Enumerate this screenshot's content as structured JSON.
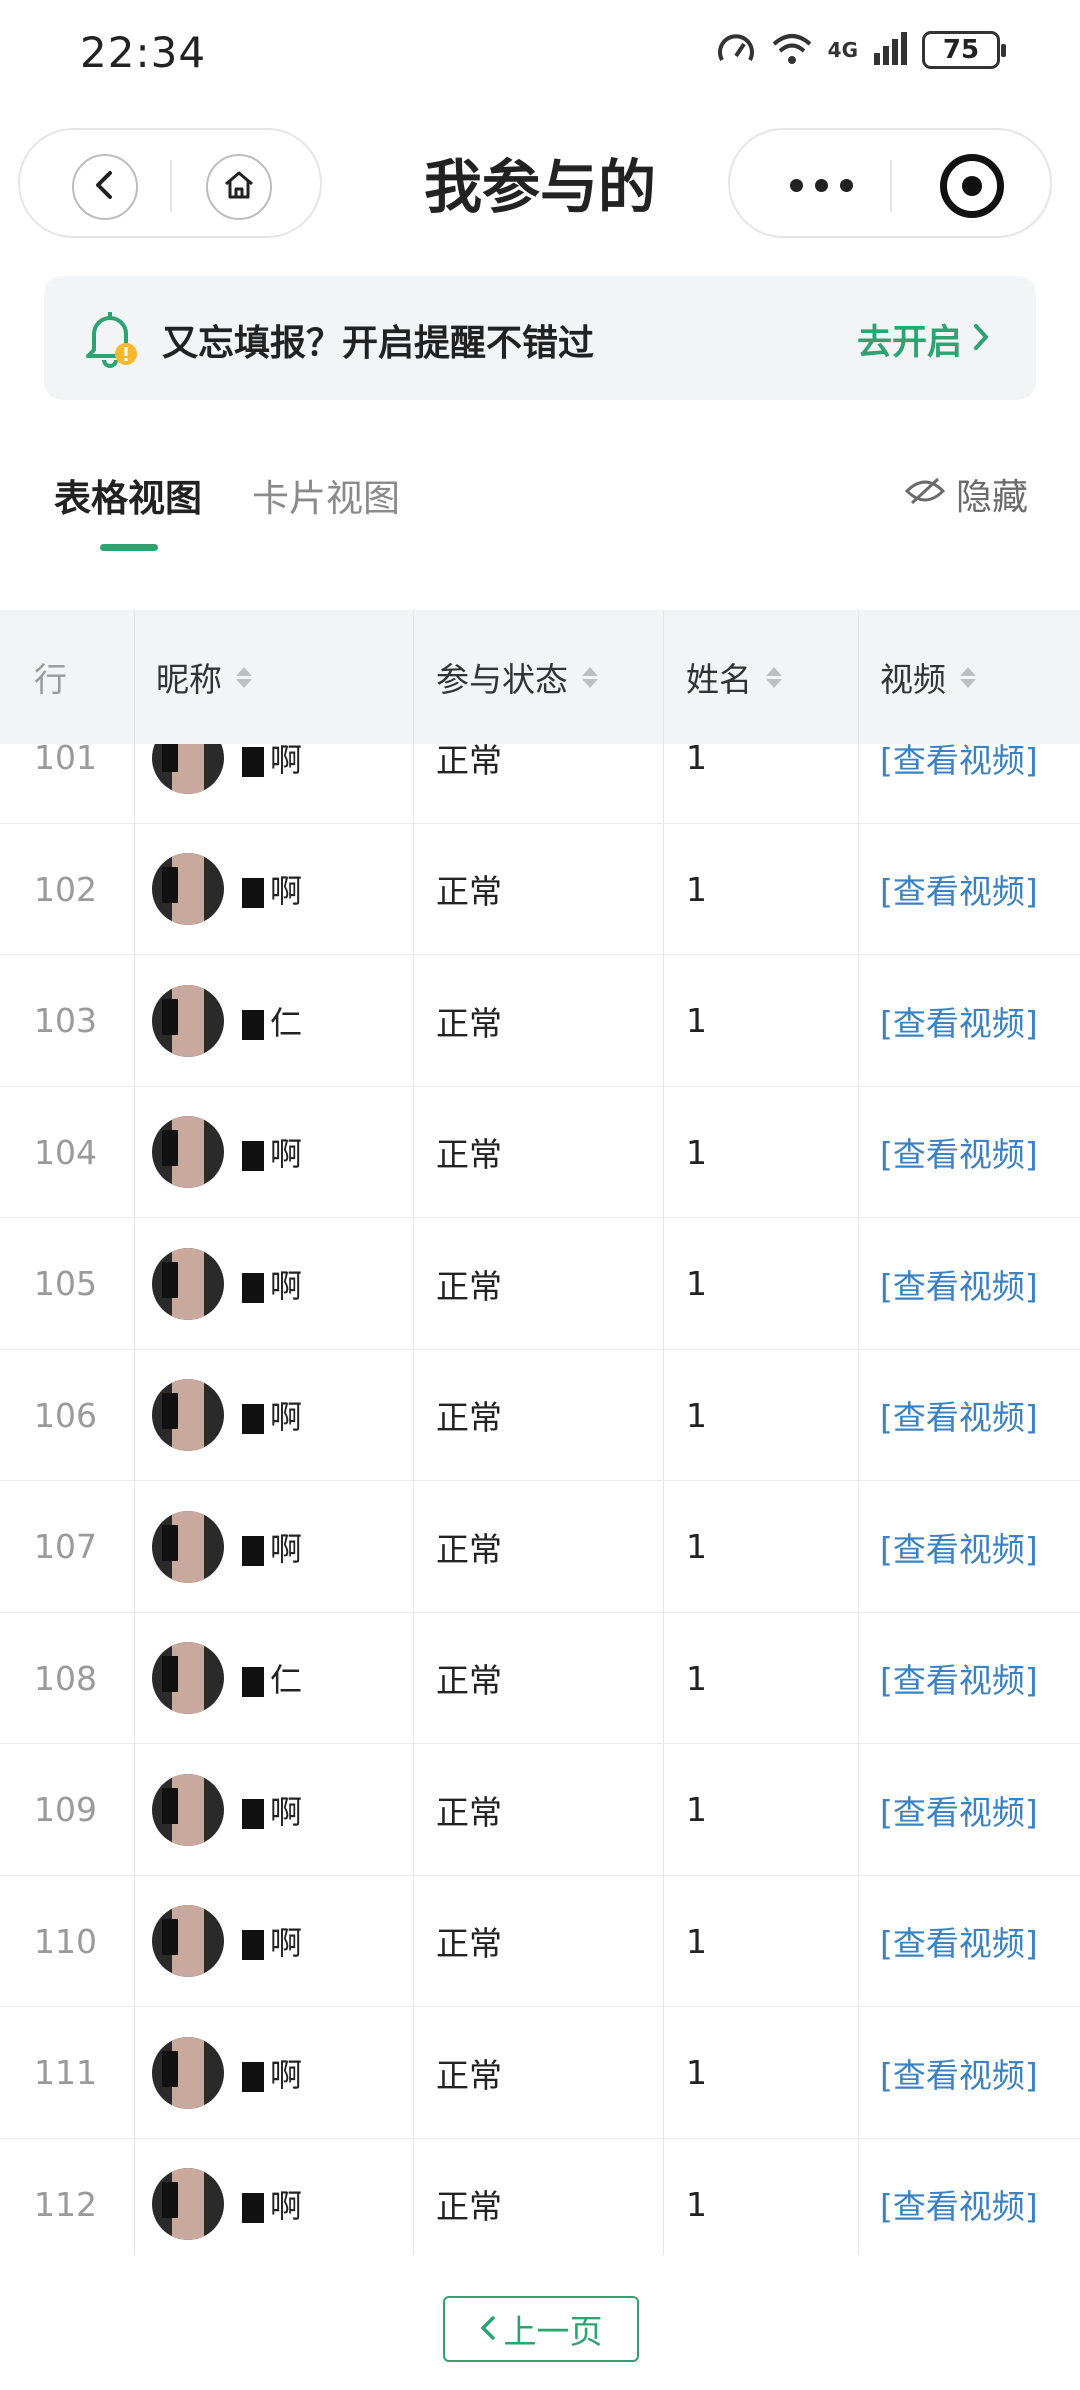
{
  "status_bar": {
    "time": "22:34",
    "network": "4G",
    "network_sup": "6",
    "battery": "75"
  },
  "nav": {
    "title": "我参与的"
  },
  "banner": {
    "text": "又忘填报？开启提醒不错过",
    "action": "去开启"
  },
  "tabs": [
    {
      "label": "表格视图",
      "active": true
    },
    {
      "label": "卡片视图",
      "active": false
    }
  ],
  "hide_label": "隐藏",
  "table": {
    "headers": {
      "row": "行",
      "nickname": "昵称",
      "status": "参与状态",
      "name": "姓名",
      "video": "视频"
    },
    "rows": [
      {
        "num": "101",
        "nickname": "啊",
        "status": "正常",
        "name": "1",
        "video": "[查看视频]"
      },
      {
        "num": "102",
        "nickname": "啊",
        "status": "正常",
        "name": "1",
        "video": "[查看视频]"
      },
      {
        "num": "103",
        "nickname": "仁",
        "status": "正常",
        "name": "1",
        "video": "[查看视频]"
      },
      {
        "num": "104",
        "nickname": "啊",
        "status": "正常",
        "name": "1",
        "video": "[查看视频]"
      },
      {
        "num": "105",
        "nickname": "啊",
        "status": "正常",
        "name": "1",
        "video": "[查看视频]"
      },
      {
        "num": "106",
        "nickname": "啊",
        "status": "正常",
        "name": "1",
        "video": "[查看视频]"
      },
      {
        "num": "107",
        "nickname": "啊",
        "status": "正常",
        "name": "1",
        "video": "[查看视频]"
      },
      {
        "num": "108",
        "nickname": "仁",
        "status": "正常",
        "name": "1",
        "video": "[查看视频]"
      },
      {
        "num": "109",
        "nickname": "啊",
        "status": "正常",
        "name": "1",
        "video": "[查看视频]"
      },
      {
        "num": "110",
        "nickname": "啊",
        "status": "正常",
        "name": "1",
        "video": "[查看视频]"
      },
      {
        "num": "111",
        "nickname": "啊",
        "status": "正常",
        "name": "1",
        "video": "[查看视频]"
      },
      {
        "num": "112",
        "nickname": "啊",
        "status": "正常",
        "name": "1",
        "video": "[查看视频]"
      }
    ]
  },
  "pager": {
    "prev_label": "上一页"
  },
  "colors": {
    "accent": "#2ba471",
    "link": "#3b82c4",
    "header_bg": "#f3f4f6",
    "banner_bg": "#f3f4f5"
  },
  "icons": [
    "back-icon",
    "home-icon",
    "more-icon",
    "target-icon",
    "bell-icon",
    "chevron-right-icon",
    "eye-off-icon",
    "sort-icon",
    "chevron-left-icon"
  ]
}
